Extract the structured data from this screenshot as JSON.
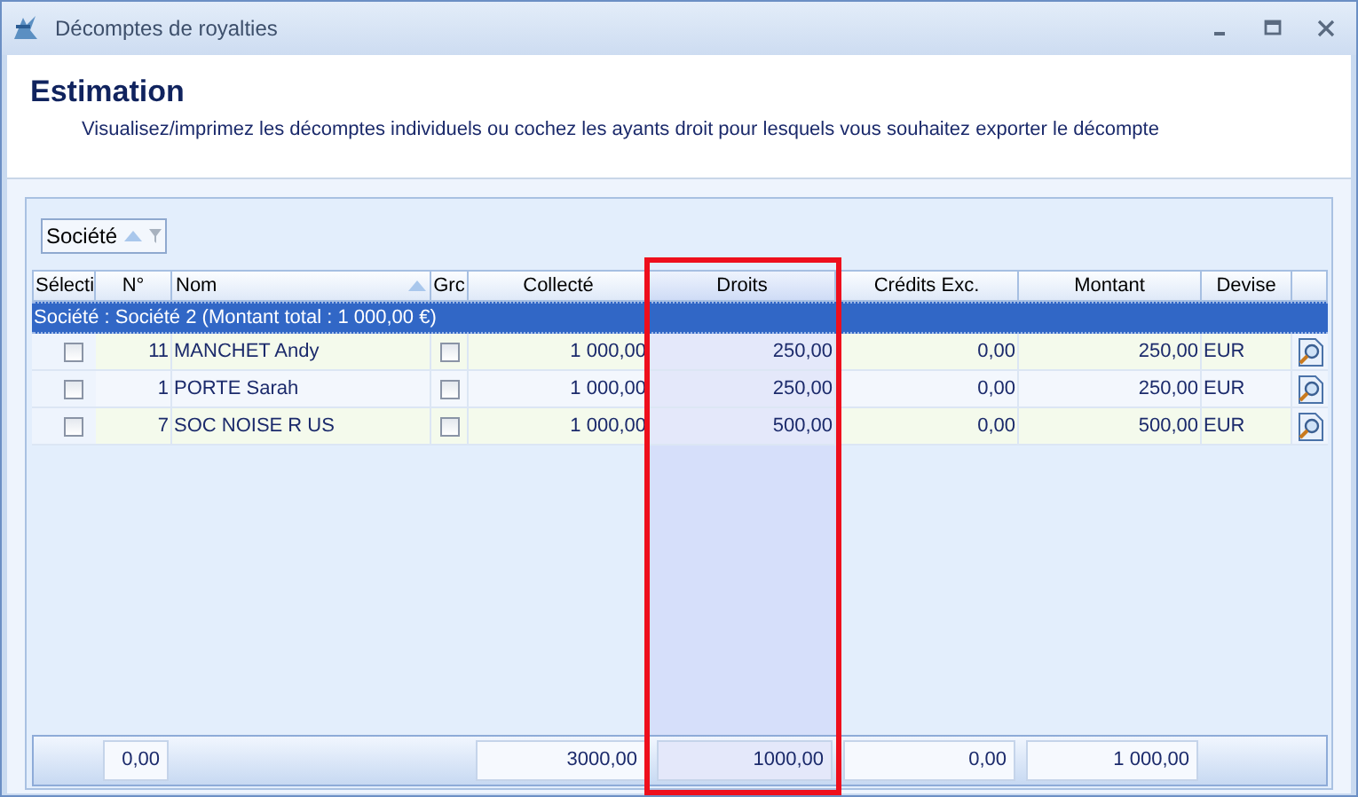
{
  "window": {
    "title": "Décomptes de royalties"
  },
  "header": {
    "title": "Estimation",
    "description": "Visualisez/imprimez les décomptes individuels ou cochez les ayants droit pour lesquels vous souhaitez exporter le décompte"
  },
  "group_panel": {
    "label": "Société"
  },
  "columns": [
    {
      "label": "Sélecti",
      "sorted": false,
      "highlighted": false
    },
    {
      "label": "N°",
      "sorted": false,
      "highlighted": false
    },
    {
      "label": "Nom",
      "sorted": true,
      "highlighted": false
    },
    {
      "label": "Grc",
      "sorted": false,
      "highlighted": false
    },
    {
      "label": "Collecté",
      "sorted": false,
      "highlighted": false
    },
    {
      "label": "Droits",
      "sorted": false,
      "highlighted": true
    },
    {
      "label": "Crédits Exc.",
      "sorted": false,
      "highlighted": false
    },
    {
      "label": "Montant",
      "sorted": false,
      "highlighted": false
    },
    {
      "label": "Devise",
      "sorted": false,
      "highlighted": false
    }
  ],
  "group_row": {
    "label": "Société : Société 2 (Montant total : 1 000,00 €)"
  },
  "rows": [
    {
      "checked": false,
      "number": "11",
      "name": "MANCHET Andy",
      "grc": false,
      "collecte": "1 000,00",
      "droits": "250,00",
      "credits": "0,00",
      "montant": "250,00",
      "devise": "EUR"
    },
    {
      "checked": false,
      "number": "1",
      "name": "PORTE Sarah",
      "grc": false,
      "collecte": "1 000,00",
      "droits": "250,00",
      "credits": "0,00",
      "montant": "250,00",
      "devise": "EUR"
    },
    {
      "checked": false,
      "number": "7",
      "name": "SOC NOISE R US",
      "grc": false,
      "collecte": "1 000,00",
      "droits": "500,00",
      "credits": "0,00",
      "montant": "500,00",
      "devise": "EUR"
    }
  ],
  "totals": {
    "number": "0,00",
    "collecte": "3000,00",
    "droits": "1000,00",
    "credits": "0,00",
    "montant": "1 000,00"
  }
}
